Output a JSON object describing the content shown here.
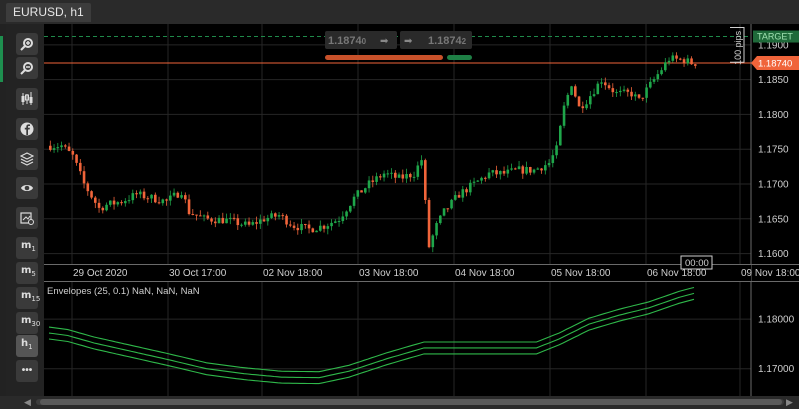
{
  "window": {
    "tab_title": "EURUSD, h1"
  },
  "toolbar": {
    "buttons": [
      {
        "name": "zoom-in-button",
        "icon": "zoom-in-icon"
      },
      {
        "name": "zoom-out-button",
        "icon": "zoom-out-icon"
      },
      {
        "name": "chart-type-button",
        "icon": "candlestick-icon"
      },
      {
        "name": "social-button",
        "icon": "facebook-icon"
      },
      {
        "name": "layers-button",
        "icon": "layers-icon"
      },
      {
        "name": "view-button",
        "icon": "eye-icon"
      },
      {
        "name": "object-settings-button",
        "icon": "chart-settings-icon"
      }
    ],
    "timeframes": [
      {
        "main": "m",
        "sub": "1",
        "name": "timeframe-m1-button"
      },
      {
        "main": "m",
        "sub": "5",
        "name": "timeframe-m5-button"
      },
      {
        "main": "m",
        "sub": "15",
        "name": "timeframe-m15-button"
      },
      {
        "main": "m",
        "sub": "30",
        "name": "timeframe-m30-button"
      },
      {
        "main": "h",
        "sub": "1",
        "name": "timeframe-h1-button",
        "active": true
      }
    ],
    "more_label": "•••"
  },
  "trade_panel": {
    "sell_price_main": "1.1874",
    "sell_price_small": "0",
    "buy_price_main": "1.1874",
    "buy_price_small": "2",
    "sell_color": "#c8512a",
    "buy_color": "#1e7f45"
  },
  "price_axis": {
    "labels": [
      "1.1900",
      "1.1850",
      "1.1800",
      "1.1750",
      "1.1700",
      "1.1650",
      "1.1600"
    ],
    "target_label": "TARGET",
    "current_price_label": "1.18740",
    "pips_label": "100 pips",
    "time_box": "00:00"
  },
  "time_axis": {
    "labels": [
      "29 Oct 2020",
      "30 Oct 17:00",
      "02 Nov 18:00",
      "03 Nov 18:00",
      "04 Nov 18:00",
      "05 Nov 18:00",
      "06 Nov 18:00",
      "09 Nov 18:00"
    ]
  },
  "indicator": {
    "title": "Envelopes (25, 0.1) NaN, NaN, NaN",
    "axis_labels": [
      "1.18000",
      "1.17000"
    ],
    "color": "#2fb84a"
  },
  "colors": {
    "bull": "#1fa64a",
    "bear": "#f0643a",
    "target": "#1f8a4a",
    "price_line": "#f0643a",
    "grid": "#2a2a2a"
  },
  "chart_data": {
    "type": "candlestick",
    "symbol": "EURUSD",
    "timeframe": "h1",
    "ylim": [
      1.1585,
      1.193
    ],
    "current_price": 1.1874,
    "target_price": 1.1912,
    "anchors": [
      [
        0,
        1.1755
      ],
      [
        4,
        1.1755
      ],
      [
        7,
        1.174
      ],
      [
        10,
        1.17
      ],
      [
        14,
        1.1665
      ],
      [
        16,
        1.167
      ],
      [
        20,
        1.1675
      ],
      [
        24,
        1.1685
      ],
      [
        28,
        1.168
      ],
      [
        32,
        1.1675
      ],
      [
        36,
        1.169
      ],
      [
        38,
        1.166
      ],
      [
        42,
        1.165
      ],
      [
        48,
        1.1648
      ],
      [
        54,
        1.164
      ],
      [
        58,
        1.165
      ],
      [
        62,
        1.1655
      ],
      [
        66,
        1.164
      ],
      [
        70,
        1.1635
      ],
      [
        74,
        1.164
      ],
      [
        78,
        1.165
      ],
      [
        82,
        1.168
      ],
      [
        86,
        1.17
      ],
      [
        90,
        1.1715
      ],
      [
        94,
        1.1708
      ],
      [
        98,
        1.1715
      ],
      [
        100,
        1.1735
      ],
      [
        102,
        1.161
      ],
      [
        104,
        1.164
      ],
      [
        106,
        1.166
      ],
      [
        110,
        1.1685
      ],
      [
        114,
        1.17
      ],
      [
        118,
        1.1715
      ],
      [
        122,
        1.1715
      ],
      [
        126,
        1.172
      ],
      [
        130,
        1.172
      ],
      [
        134,
        1.173
      ],
      [
        136,
        1.175
      ],
      [
        138,
        1.181
      ],
      [
        140,
        1.1845
      ],
      [
        142,
        1.181
      ],
      [
        144,
        1.182
      ],
      [
        146,
        1.1835
      ],
      [
        148,
        1.185
      ],
      [
        152,
        1.183
      ],
      [
        156,
        1.183
      ],
      [
        158,
        1.182
      ],
      [
        162,
        1.185
      ],
      [
        166,
        1.188
      ],
      [
        170,
        1.1878
      ],
      [
        172,
        1.1874
      ]
    ],
    "envelope_anchors": [
      [
        0,
        1.1772
      ],
      [
        5,
        1.1767
      ],
      [
        12,
        1.1752
      ],
      [
        22,
        1.1735
      ],
      [
        32,
        1.1718
      ],
      [
        42,
        1.17
      ],
      [
        52,
        1.169
      ],
      [
        62,
        1.1683
      ],
      [
        72,
        1.1682
      ],
      [
        80,
        1.1695
      ],
      [
        90,
        1.172
      ],
      [
        100,
        1.1742
      ],
      [
        112,
        1.1742
      ],
      [
        124,
        1.1742
      ],
      [
        130,
        1.1742
      ],
      [
        136,
        1.176
      ],
      [
        144,
        1.179
      ],
      [
        152,
        1.1808
      ],
      [
        160,
        1.1823
      ],
      [
        168,
        1.1844
      ],
      [
        172,
        1.1852
      ]
    ],
    "envelope_ylim": [
      1.1645,
      1.1875
    ],
    "envelope_band_width": 0.0012
  }
}
